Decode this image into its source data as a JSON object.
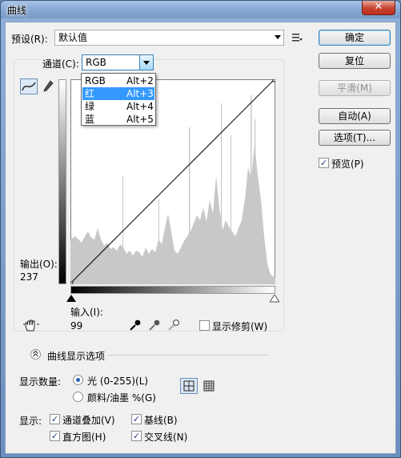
{
  "window": {
    "title": "曲线",
    "close_glyph": "✕"
  },
  "preset": {
    "label": "预设(R):",
    "value": "默认值"
  },
  "channel": {
    "label": "通道(C):",
    "value": "RGB",
    "options": [
      {
        "name": "RGB",
        "shortcut": "Alt+2"
      },
      {
        "name": "红",
        "shortcut": "Alt+3"
      },
      {
        "name": "绿",
        "shortcut": "Alt+4"
      },
      {
        "name": "蓝",
        "shortcut": "Alt+5"
      }
    ],
    "highlighted_index": 1
  },
  "buttons": {
    "ok": "确定",
    "reset": "复位",
    "smooth": "平滑(M)",
    "auto": "自动(A)",
    "options": "选项(T)..."
  },
  "preview": {
    "label": "预览(P)",
    "checked": true
  },
  "output": {
    "label": "输出(O):",
    "value": "237"
  },
  "input": {
    "label": "输入(I):",
    "value": "99"
  },
  "show_clipping": {
    "label": "显示修剪(W)",
    "checked": false
  },
  "curve_options": {
    "label": "曲线显示选项"
  },
  "show_amount": {
    "label": "显示数量:",
    "light": "光 (0-255)(L)",
    "pigment": "颜料/油墨 %(G)",
    "selected": "light"
  },
  "show": {
    "label": "显示:",
    "channel_overlay": {
      "label": "通道叠加(V)",
      "checked": true
    },
    "baseline": {
      "label": "基线(B)",
      "checked": true
    },
    "histogram": {
      "label": "直方图(H)",
      "checked": true
    },
    "intersection": {
      "label": "交叉线(N)",
      "checked": true
    }
  },
  "colors": {
    "histogram": "#c8c8c8",
    "selection": "#3399ff",
    "accent": "#3c7fb1"
  }
}
